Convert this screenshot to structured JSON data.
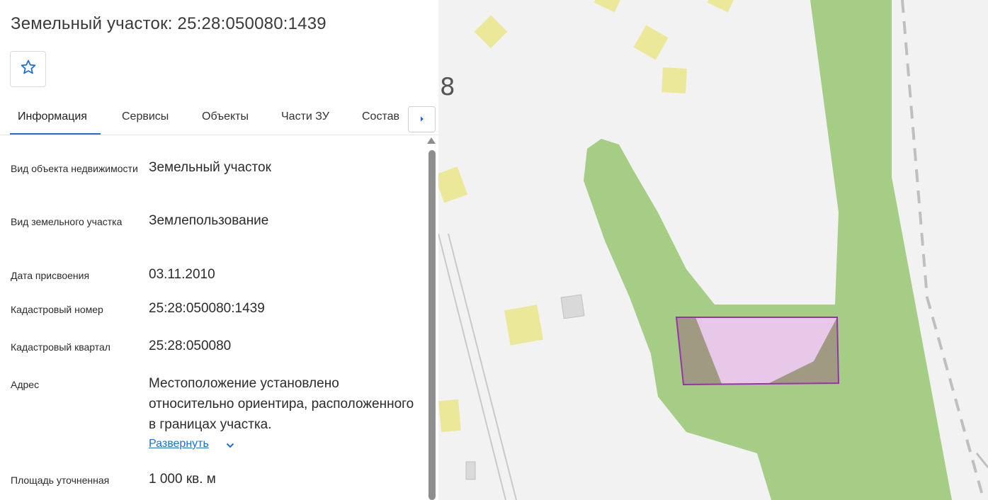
{
  "header": {
    "title": "Земельный участок: 25:28:050080:1439",
    "favorite_icon": "star-outline-icon"
  },
  "tabs": [
    {
      "label": "Информация",
      "active": true
    },
    {
      "label": "Сервисы",
      "active": false
    },
    {
      "label": "Объекты",
      "active": false
    },
    {
      "label": "Части ЗУ",
      "active": false
    },
    {
      "label": "Состав",
      "active": false
    }
  ],
  "tabs_next_icon": "chevron-right-icon",
  "info": [
    {
      "label": "Вид объекта недвижимости",
      "value": "Земельный участок"
    },
    {
      "label": "Вид земельного участка",
      "value": "Землепользование"
    },
    {
      "label": "Дата присвоения",
      "value": "03.11.2010"
    },
    {
      "label": "Кадастровый номер",
      "value": "25:28:050080:1439"
    },
    {
      "label": "Кадастровый квартал",
      "value": "25:28:050080"
    },
    {
      "label": "Адрес",
      "value": "Местоположение установлено относительно ориентира, расположенного в границах участка."
    },
    {
      "label": "Площадь уточненная",
      "value": "1 000 кв. м"
    }
  ],
  "address_expand": "Развернуть",
  "map": {
    "label_fragment": "8",
    "colors": {
      "background": "#f2f2f2",
      "green_area": "#a6cd86",
      "building": "#ece89a",
      "building_gray": "#d9d9d9",
      "parcel_fill": "#e8c8e8",
      "parcel_stroke": "#9a2fb0",
      "road_dash": "#bfbfbf"
    }
  }
}
